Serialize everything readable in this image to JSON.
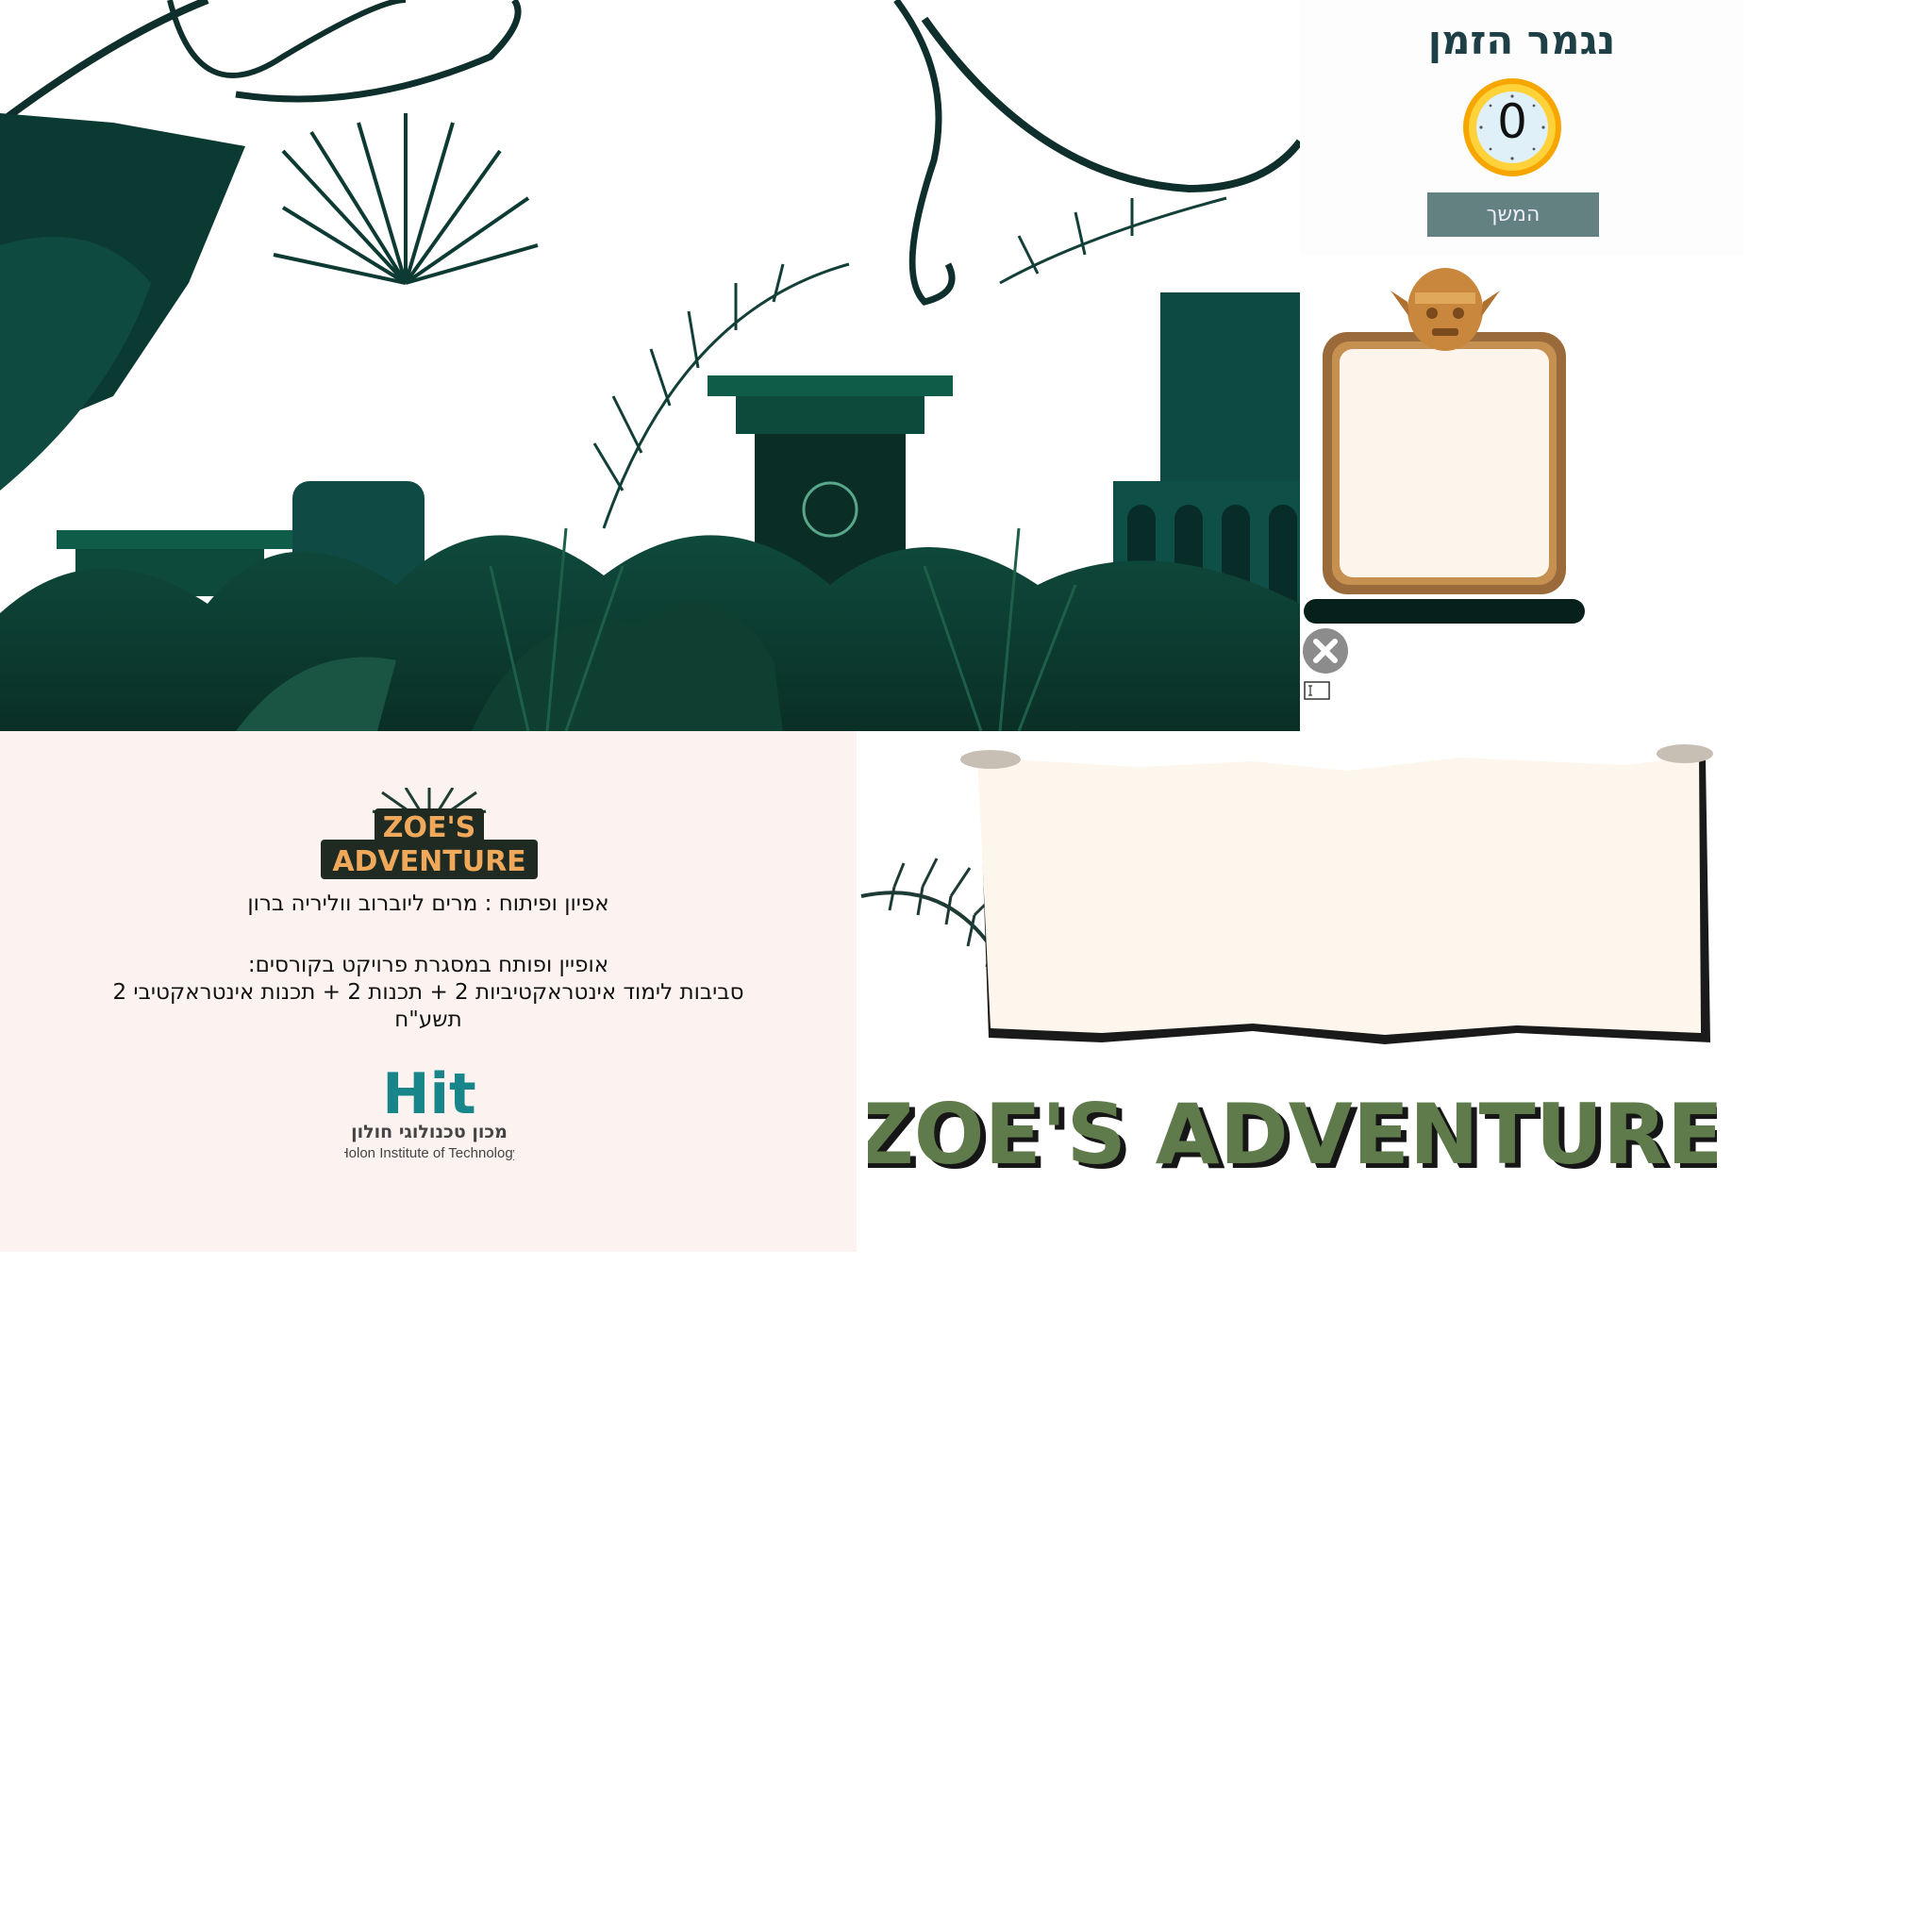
{
  "timeup": {
    "title": "נגמר הזמן",
    "timer_value": "0",
    "continue_label": "המשך"
  },
  "credits": {
    "logo_line1": "ZOE'S",
    "logo_line2": "ADVENTURE",
    "design_credit": "אפיון ופיתוח : מרים ליוברוב ווליריה ברון",
    "course_intro": "אופיין ופותח במסגרת פרויקט בקורסים:",
    "courses": "סביבות לימוד אינטראקטיביות 2 +  תכנות 2 + תכנות אינטראקטיבי 2",
    "year": "תשע\"ח",
    "institute_mark": "Hit",
    "institute_he": "מכון טכנולוגי חולון",
    "institute_en": "Holon Institute of Technology"
  },
  "game_title": "ZOE'S ADVENTURE",
  "icons": {
    "close": "close-icon",
    "timer": "clock-icon",
    "mask": "tribal-mask-icon",
    "fern": "fern-icon"
  },
  "colors": {
    "panel_title": "#1d3f45",
    "continue_bg": "#648181",
    "credits_bg": "#fcf3f0",
    "title_green": "#5f7a4b",
    "frame_brown": "#9b6a3a",
    "timer_ring": "#f5b400"
  }
}
